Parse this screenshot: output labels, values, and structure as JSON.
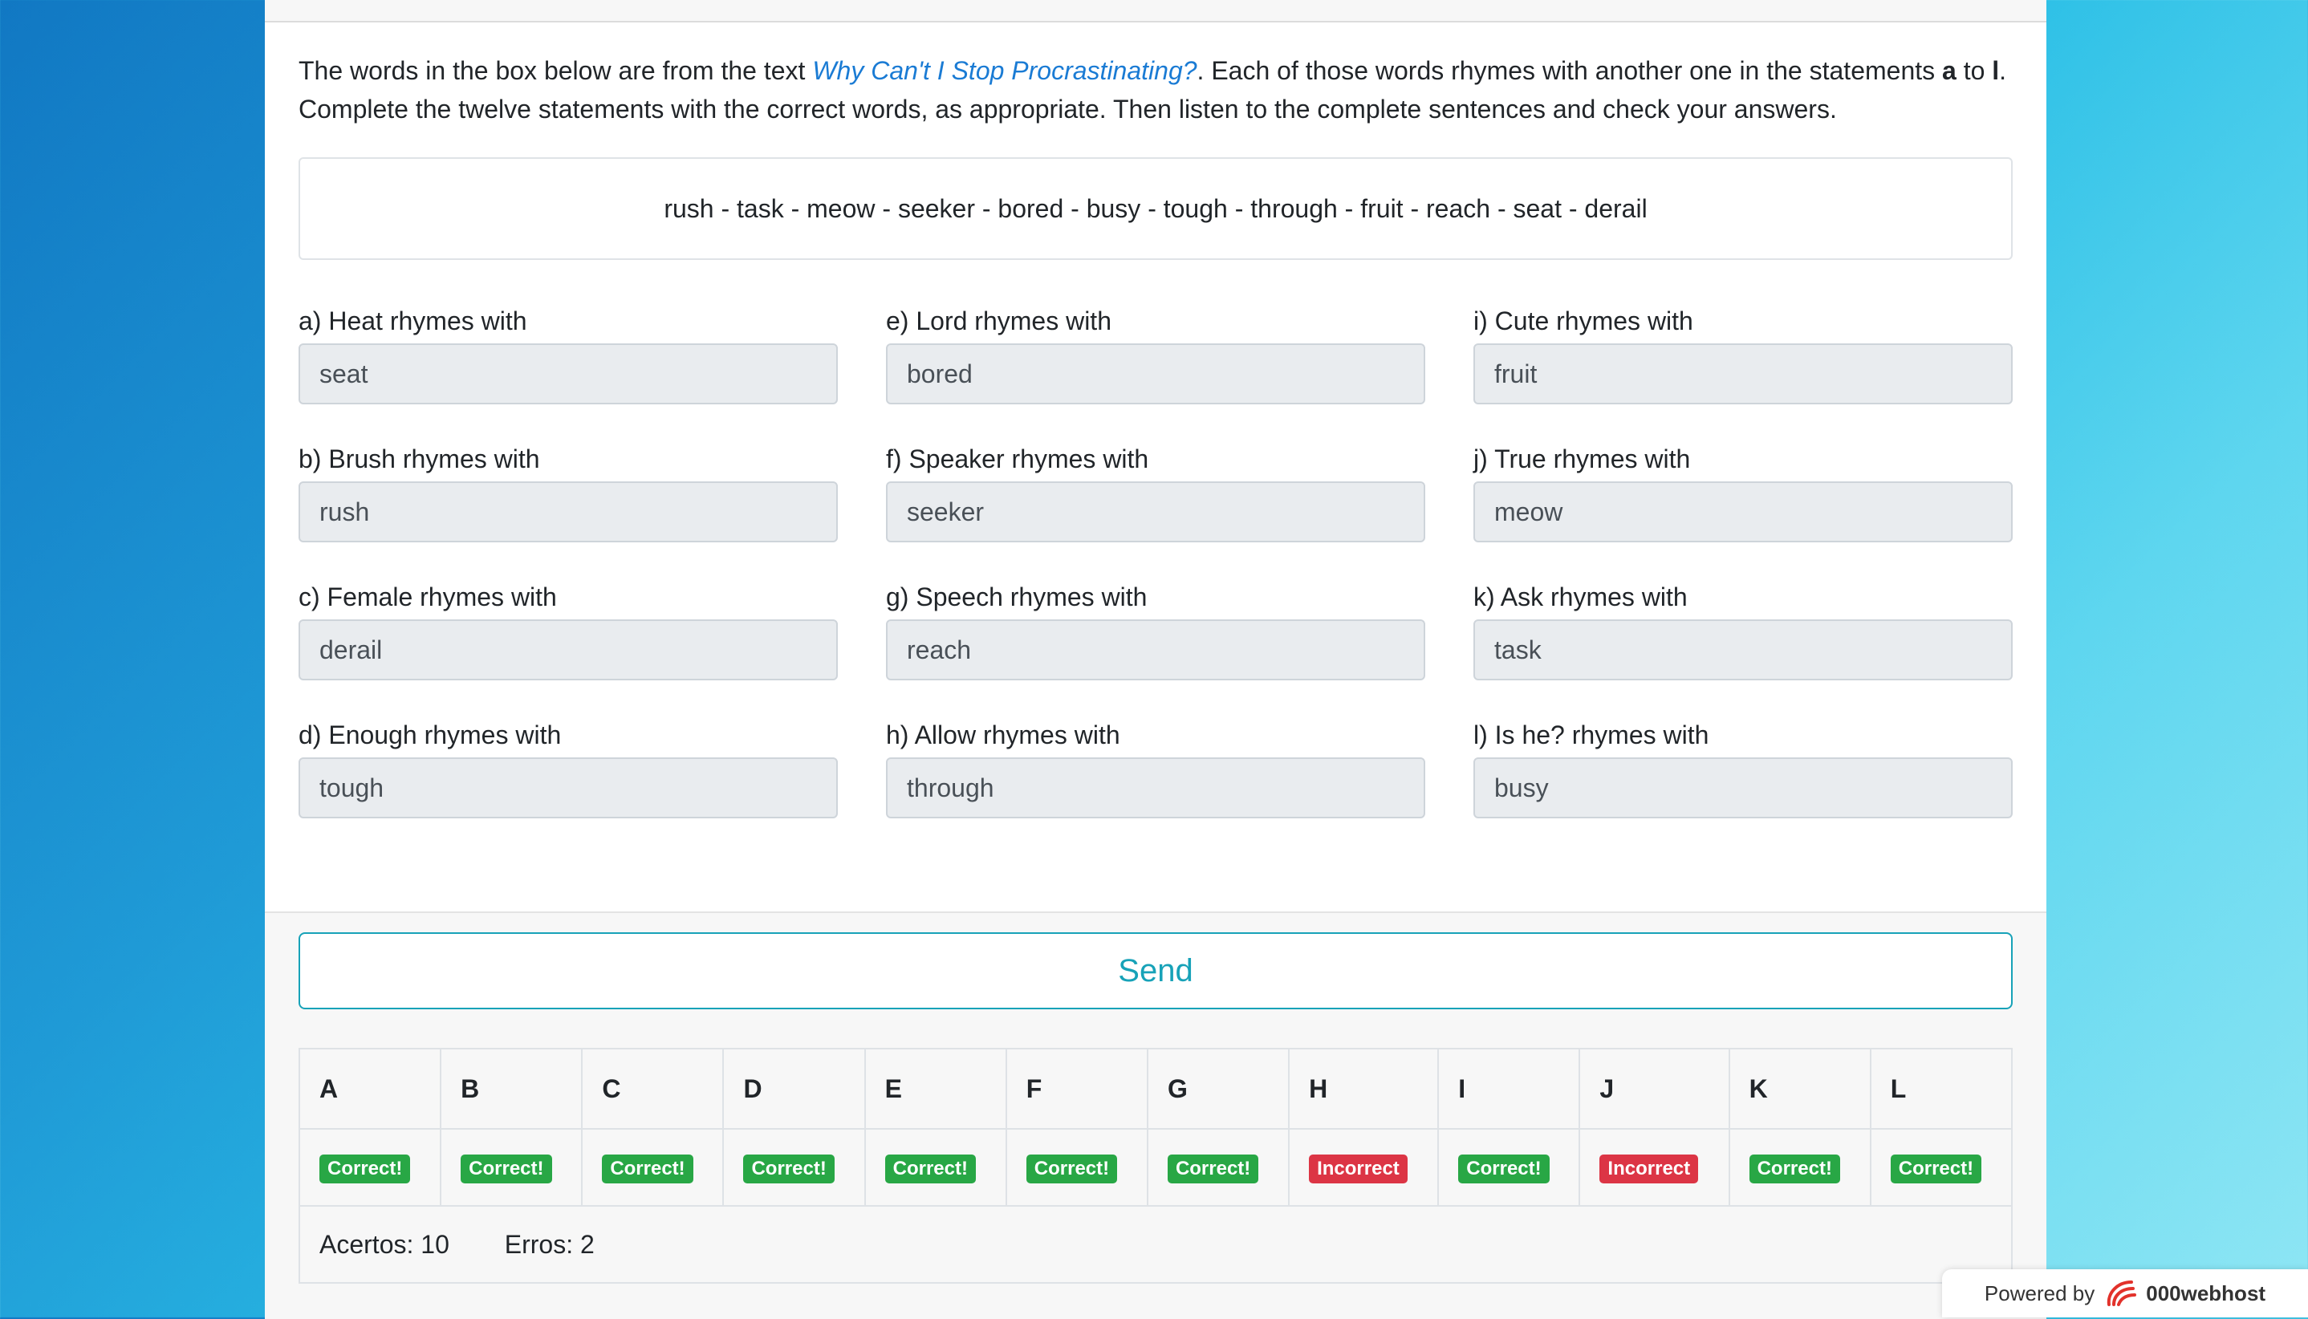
{
  "intro": {
    "part1": "The words in the box below are from the text ",
    "link": "Why Can't I Stop Procrastinating?",
    "part2": ". Each of those words rhymes with another one in the statements ",
    "a": "a",
    "to": " to ",
    "l": "l",
    "part3": ". Complete the twelve statements with the correct words, as appropriate. Then listen to the complete sentences and check your answers."
  },
  "wordbox": "rush - task - meow - seeker - bored - busy - tough - through - fruit - reach - seat - derail",
  "fields": [
    {
      "label": "a) Heat rhymes with",
      "value": "seat"
    },
    {
      "label": "b) Brush rhymes with",
      "value": "rush"
    },
    {
      "label": "c) Female rhymes with",
      "value": "derail"
    },
    {
      "label": "d) Enough rhymes with",
      "value": "tough"
    },
    {
      "label": "e) Lord rhymes with",
      "value": "bored"
    },
    {
      "label": "f) Speaker rhymes with",
      "value": "seeker"
    },
    {
      "label": "g) Speech rhymes with",
      "value": "reach"
    },
    {
      "label": "h) Allow rhymes with",
      "value": "through"
    },
    {
      "label": "i) Cute rhymes with",
      "value": "fruit"
    },
    {
      "label": "j) True rhymes with",
      "value": "meow"
    },
    {
      "label": "k) Ask rhymes with",
      "value": "task"
    },
    {
      "label": "l) Is he? rhymes with",
      "value": "busy"
    }
  ],
  "send_label": "Send",
  "results": {
    "headers": [
      "A",
      "B",
      "C",
      "D",
      "E",
      "F",
      "G",
      "H",
      "I",
      "J",
      "K",
      "L"
    ],
    "status": [
      "Correct!",
      "Correct!",
      "Correct!",
      "Correct!",
      "Correct!",
      "Correct!",
      "Correct!",
      "Incorrect",
      "Correct!",
      "Incorrect",
      "Correct!",
      "Correct!"
    ],
    "acertos": "Acertos: 10",
    "erros": "Erros: 2"
  },
  "powered": {
    "prefix": "Powered by",
    "brand": "000webhost"
  },
  "colors": {
    "correct": "#28a745",
    "incorrect": "#dc3545",
    "accent": "#17a2b8",
    "link": "#1a7bd4"
  }
}
